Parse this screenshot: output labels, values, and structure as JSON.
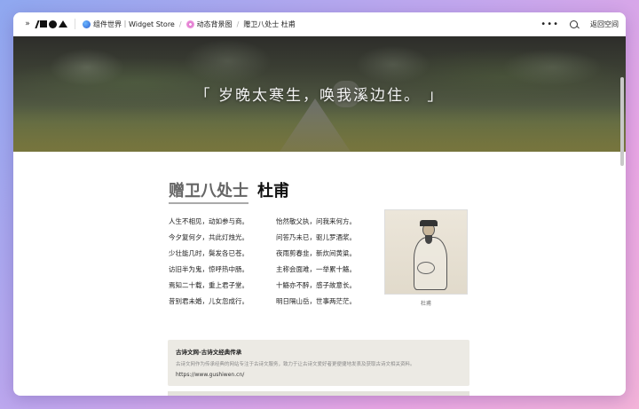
{
  "topbar": {
    "breadcrumbs": [
      {
        "label": "组件世界｜Widget Store"
      },
      {
        "label": "动态背景图"
      },
      {
        "label": "赠卫八处士 杜甫"
      }
    ],
    "back_label": "返回空间"
  },
  "hero": {
    "quote": "「 岁晚太寒生，唤我溪边住。 」"
  },
  "poem": {
    "title": "赠卫八处士",
    "author": "杜甫",
    "column1": [
      "人生不相见，动如参与商。",
      "今夕复何夕，共此灯烛光。",
      "少壮能几时，鬓发各已苍。",
      "访旧半为鬼，惊呼热中肠。",
      "焉知二十载，重上君子堂。",
      "昔别君未婚，儿女忽成行。"
    ],
    "column2": [
      "怡然敬父执，问我来何方。",
      "问答乃未已，驱儿罗酒浆。",
      "夜雨剪春韭，新炊间黄粱。",
      "主称会面难，一举累十觞。",
      "十觞亦不醉，感子故意长。",
      "明日隔山岳，世事两茫茫。"
    ],
    "portrait_caption": "杜甫"
  },
  "info": {
    "title": "古诗文网-古诗文经典传承",
    "description": "古诗文网作为传承经典的网站专注于古诗文服务，致力于让古诗文爱好者更便捷地发表及获取古诗文相关资料。",
    "url": "https://www.gushiwen.cn/"
  }
}
